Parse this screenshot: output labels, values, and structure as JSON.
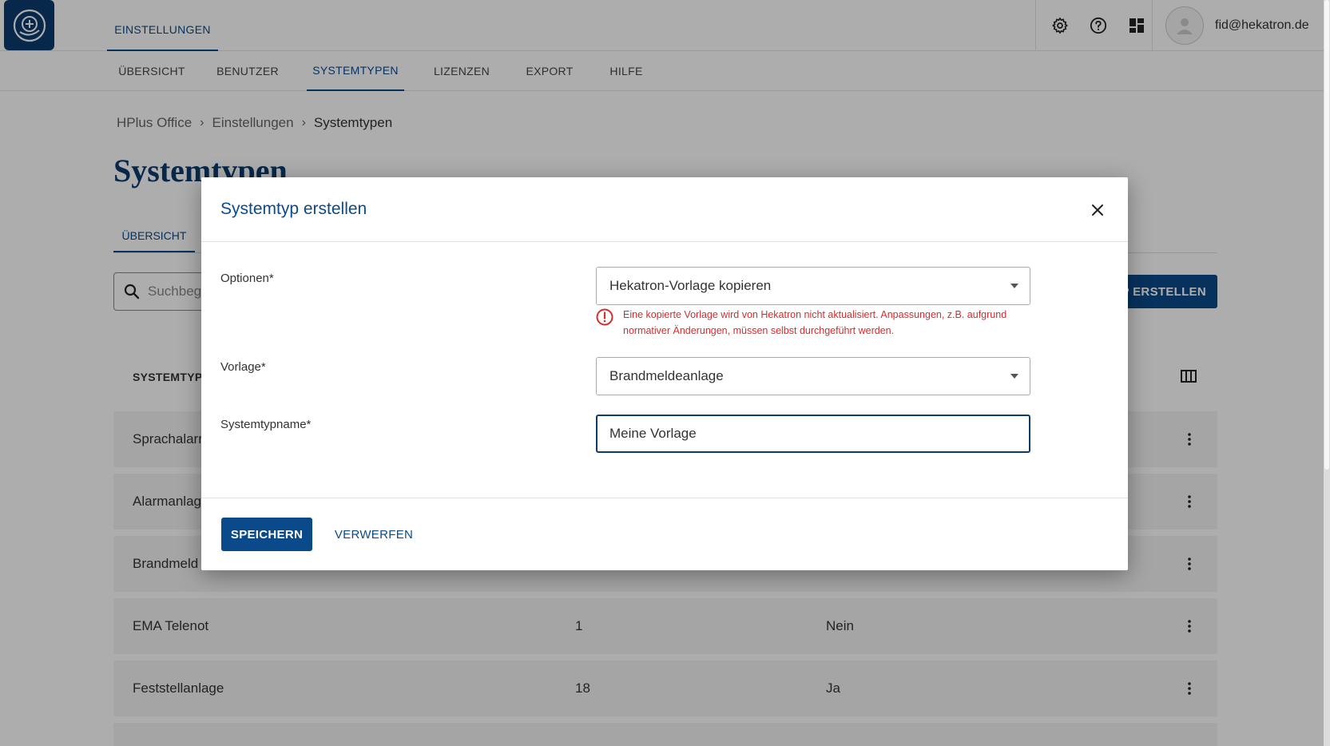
{
  "header": {
    "main_tab": "EINSTELLUNGEN",
    "user_email": "fid@hekatron.de",
    "icons": [
      "settings-icon",
      "help-icon",
      "apps-grid-icon"
    ]
  },
  "subnav": {
    "items": [
      "ÜBERSICHT",
      "BENUTZER",
      "SYSTEMTYPEN",
      "LIZENZEN",
      "EXPORT",
      "HILFE"
    ],
    "active": "SYSTEMTYPEN"
  },
  "breadcrumb": [
    "HPlus Office",
    "Einstellungen",
    "Systemtypen"
  ],
  "page": {
    "title": "Systemtypen",
    "tab": "ÜBERSICHT",
    "search_placeholder": "Suchbegr",
    "create_button": "P ERSTELLEN",
    "column_header": "SYSTEMTYPN"
  },
  "table": {
    "rows": [
      {
        "name": "Sprachalarr",
        "count": "",
        "flag": ""
      },
      {
        "name": "Alarmanlag",
        "count": "",
        "flag": ""
      },
      {
        "name": "Brandmeld",
        "count": "",
        "flag": ""
      },
      {
        "name": "EMA Telenot",
        "count": "1",
        "flag": "Nein"
      },
      {
        "name": "Feststellanlage",
        "count": "18",
        "flag": "Ja"
      }
    ]
  },
  "modal": {
    "title": "Systemtyp erstellen",
    "fields": {
      "options_label": "Optionen*",
      "options_value": "Hekatron-Vorlage kopieren",
      "warning": "Eine kopierte Vorlage wird von Hekatron nicht aktualisiert. Anpassungen, z.B. aufgrund normativer Änderungen, müssen selbst durchgeführt werden.",
      "template_label": "Vorlage*",
      "template_value": "Brandmeldeanlage",
      "name_label": "Systemtypname*",
      "name_value": "Meine Vorlage"
    },
    "save_label": "SPEICHERN",
    "discard_label": "VERWERFEN"
  },
  "colors": {
    "brand": "#0b4a8a",
    "brand_dark": "#0b3b6e",
    "warning": "#d62c2c"
  }
}
